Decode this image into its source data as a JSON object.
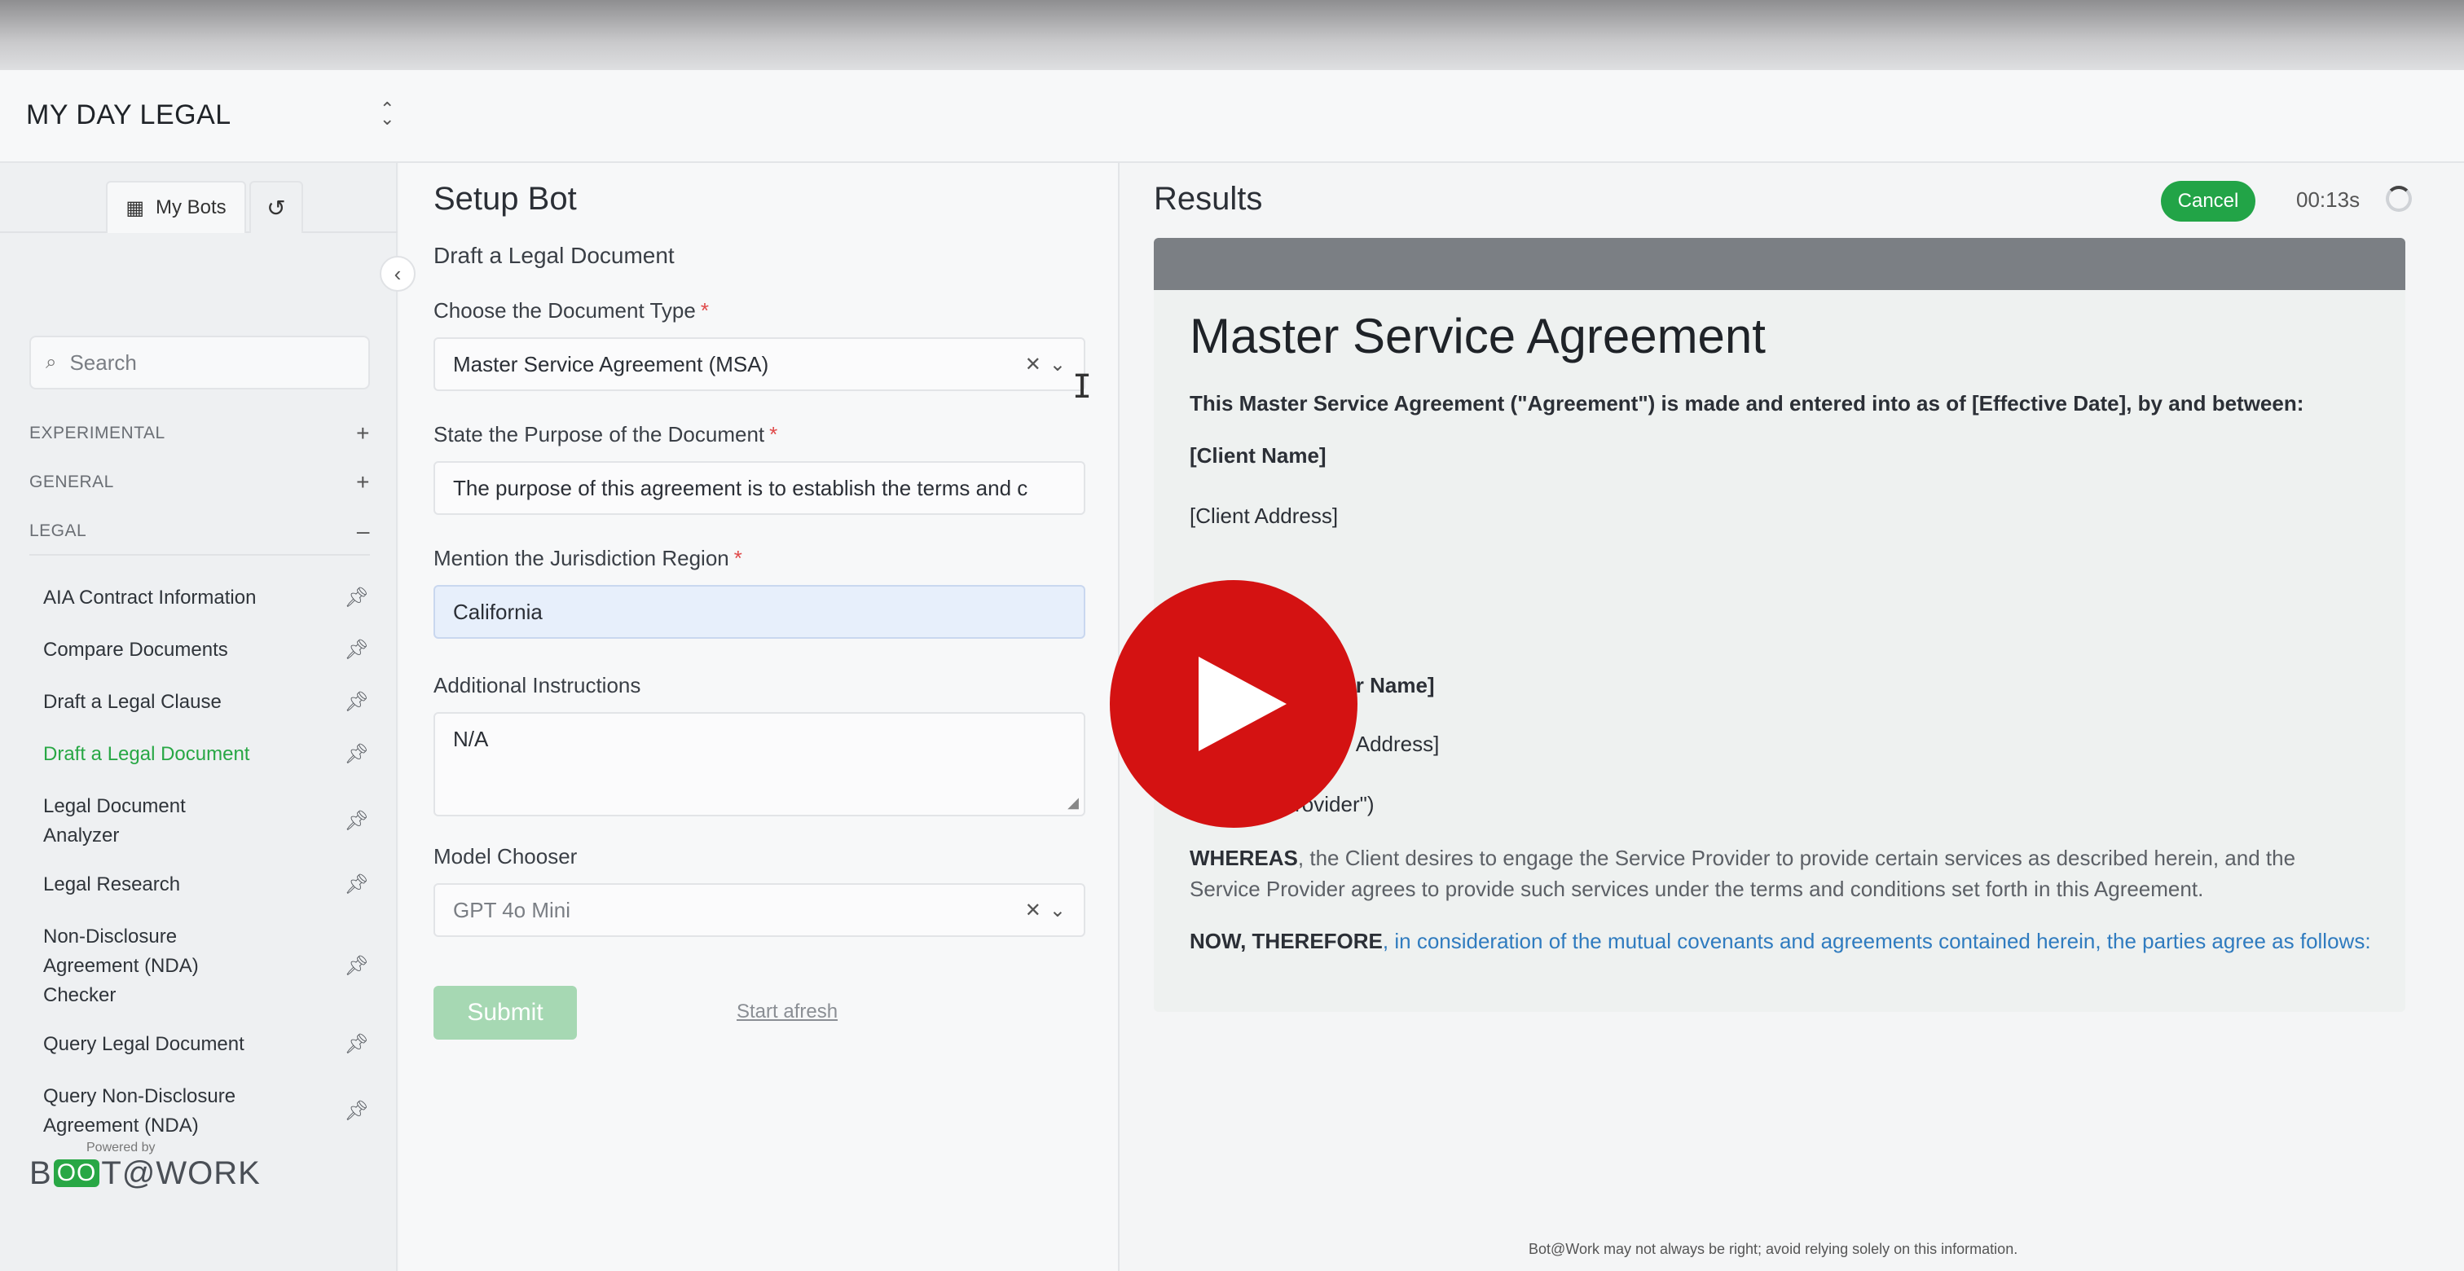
{
  "app": {
    "brand": "MY DAY LEGAL",
    "brand_toggle_icon": "chevron-updown-icon"
  },
  "sidebar": {
    "tab_my_bots": "My Bots",
    "tab_history_icon": "history-icon",
    "search_placeholder": "Search",
    "sections": [
      {
        "label": "EXPERIMENTAL",
        "sign": "+"
      },
      {
        "label": "GENERAL",
        "sign": "+"
      },
      {
        "label": "LEGAL",
        "sign": "–"
      }
    ],
    "items": [
      {
        "label": "AIA Contract Information"
      },
      {
        "label": "Compare Documents"
      },
      {
        "label": "Draft a Legal Clause"
      },
      {
        "label": "Draft a Legal Document",
        "active": true
      },
      {
        "label": "Legal Document Analyzer"
      },
      {
        "label": "Legal Research"
      },
      {
        "label": "Non-Disclosure Agreement (NDA) Checker"
      },
      {
        "label": "Query Legal Document"
      },
      {
        "label": "Query Non-Disclosure Agreement (NDA)"
      }
    ],
    "powered_by": "Powered by",
    "logo_pre": "B",
    "logo_bot": "OO",
    "logo_post": "T@WORK"
  },
  "setup": {
    "title": "Setup Bot",
    "subtitle": "Draft a Legal Document",
    "doc_type_label": "Choose the Document Type",
    "doc_type_value": "Master Service Agreement (MSA)",
    "purpose_label": "State the Purpose of the Document",
    "purpose_value": "The purpose of this agreement is to establish the terms and c",
    "jurisdiction_label": "Mention the Jurisdiction Region",
    "jurisdiction_value": "California",
    "instructions_label": "Additional Instructions",
    "instructions_value": "N/A",
    "model_label": "Model Chooser",
    "model_value": "GPT 4o Mini",
    "required_mark": "*",
    "submit": "Submit",
    "start_afresh": "Start afresh"
  },
  "results": {
    "title": "Results",
    "cancel": "Cancel",
    "timer": "00:13s",
    "doc": {
      "heading": "Master Service Agreement",
      "intro": "This Master Service Agreement (\"Agreement\") is made and entered into as of [Effective Date], by and between:",
      "client_name": "[Client Name]",
      "client_address": "[Client Address]",
      "provider_name": "[Service Provider Name]",
      "provider_address": "[Service Provider Address]",
      "provider_role": "(\"Service Provider\")",
      "whereas_lead": "WHEREAS",
      "whereas_text": ", the Client desires to engage the Service Provider to provide certain services as described herein, and the Service Provider agrees to provide such services under the terms and conditions set forth in this Agreement.",
      "now_lead": "NOW, THEREFORE",
      "now_text": ", in consideration of the mutual covenants and agreements contained herein, the parties agree as follows:"
    },
    "footnote": "Bot@Work may not always be right; avoid relying solely on this information."
  }
}
